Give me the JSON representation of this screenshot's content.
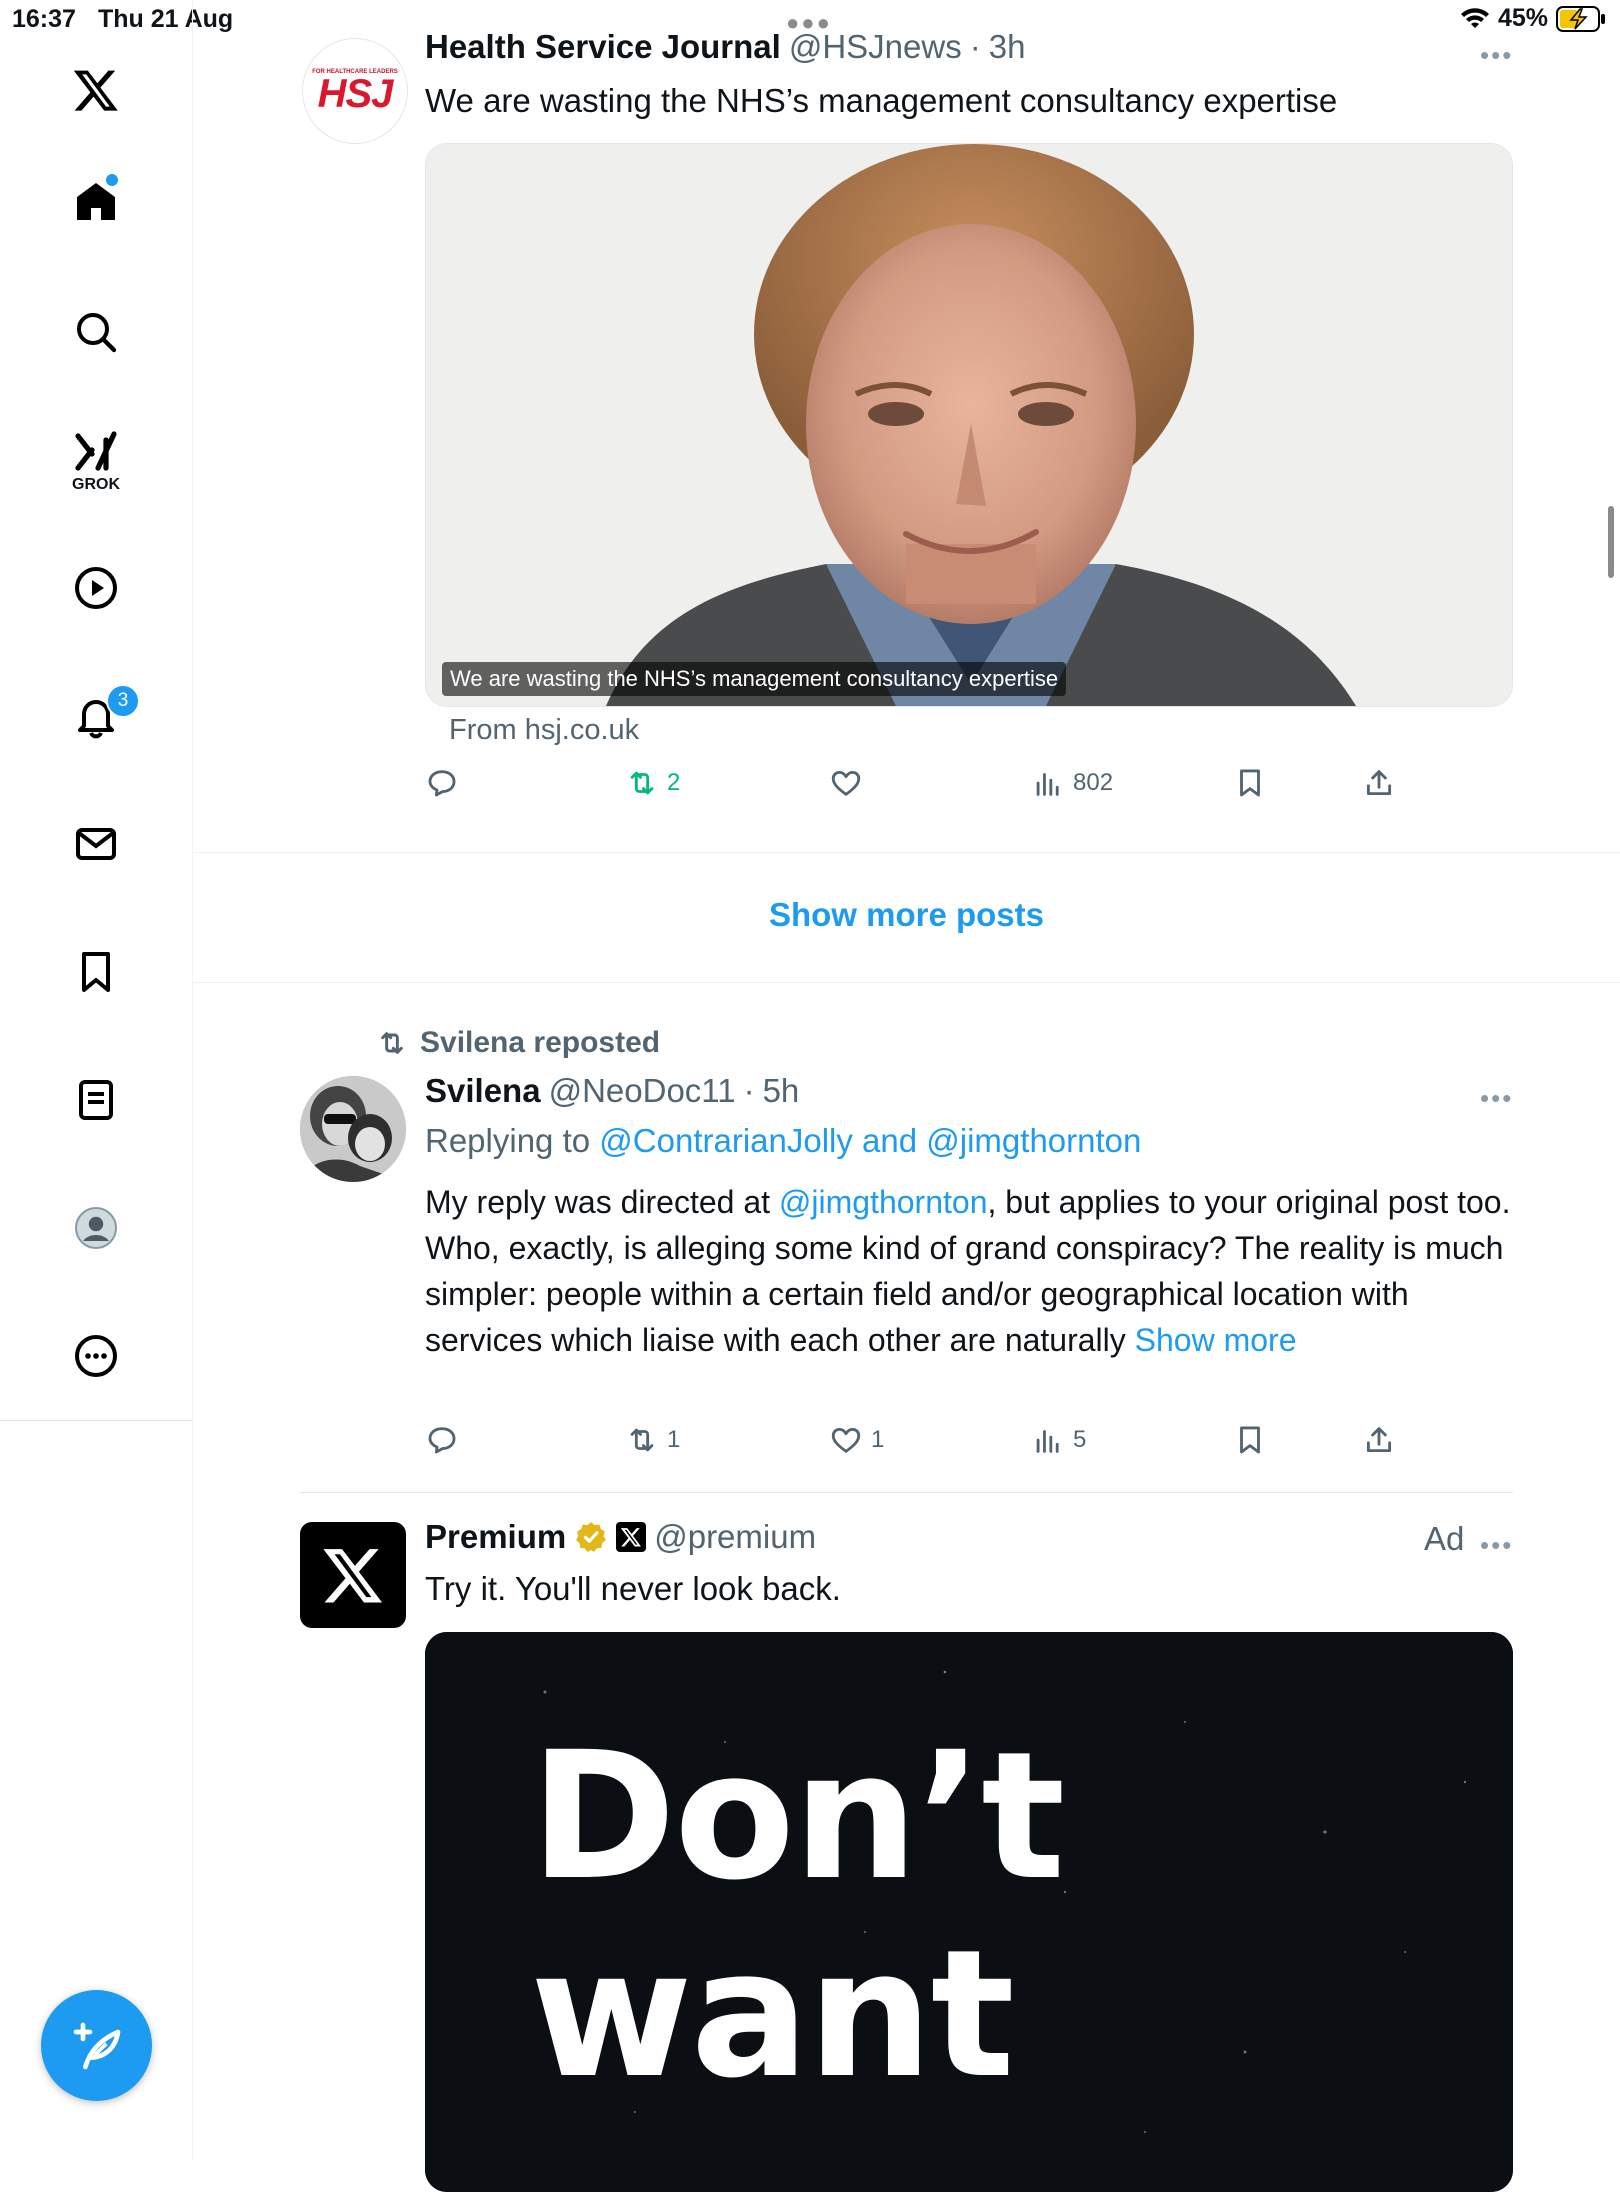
{
  "status_bar": {
    "time": "16:37",
    "date": "Thu 21 Aug",
    "battery": "45%"
  },
  "sidebar": {
    "grok_label": "GROK",
    "notifications_count": "3",
    "items": [
      "x-logo",
      "home",
      "search",
      "grok",
      "video",
      "notifications",
      "messages",
      "bookmarks",
      "lists",
      "profile",
      "more"
    ]
  },
  "post1": {
    "name": "Health Service Journal",
    "handle": "@HSJnews",
    "sep": "·",
    "time": "3h",
    "text": "We are wasting the NHS’s management consultancy expertise",
    "avatar_text": "HSJ",
    "avatar_small": "FOR HEALTHCARE LEADERS",
    "card_caption": "We are wasting the NHS’s management consultancy expertise",
    "card_source": "From hsj.co.uk",
    "reposts": "2",
    "views": "802"
  },
  "show_more_posts": "Show more posts",
  "post2": {
    "repost_label": "Svilena reposted",
    "name": "Svilena",
    "handle": "@NeoDoc11",
    "sep": "·",
    "time": "5h",
    "replying_prefix": "Replying to",
    "replying_users": "@ContrarianJolly and @jimgthornton",
    "text_pre": "My reply was directed at",
    "text_mention": "@jimgthornton",
    "text_post": ", but applies to your original post too. Who, exactly, is alleging some kind of grand conspiracy? The reality is much simpler: people within a certain field and/or geographical location with services which liaise with each other are naturally",
    "show_more": "Show more",
    "reposts": "1",
    "likes": "1",
    "views": "5"
  },
  "post3": {
    "name": "Premium",
    "handle": "@premium",
    "ad_label": "Ad",
    "text": "Try it. You'll never look back.",
    "promo_line1": "Don’t",
    "promo_line2": "want"
  },
  "colors": {
    "accent": "#1d9bf0",
    "repost_active": "#00ba7c",
    "muted": "#536471"
  }
}
